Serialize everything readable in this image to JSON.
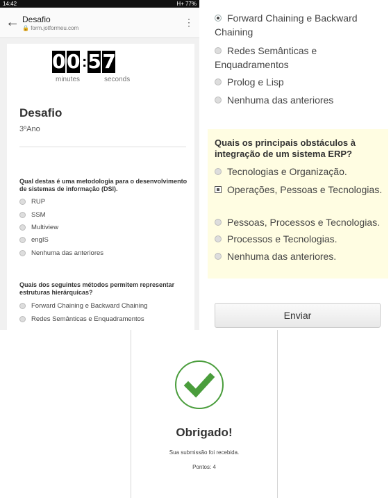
{
  "status_bar": {
    "time": "14:42",
    "indicators": "H+ 77%"
  },
  "header": {
    "title": "Desafio",
    "url": "form.jotformeu.com",
    "back_icon": "back-arrow-icon",
    "menu_icon": "more-vert-icon"
  },
  "timer": {
    "minute_digits": [
      "0",
      "0"
    ],
    "second_digits": [
      "5",
      "7"
    ],
    "separator": ":",
    "minutes_label": "minutes",
    "seconds_label": "seconds"
  },
  "form": {
    "title": "Desafio",
    "subtitle": "3ºAno",
    "q1": {
      "question": "Qual destas é uma metodologia para o desenvolvimento de sistemas de informação (DSI).",
      "options": [
        "RUP",
        "SSM",
        "Multiview",
        "engIS",
        "Nenhuma das anteriores"
      ]
    },
    "q2": {
      "question": "Quais dos seguintes métodos permitem representar estruturas hierárquicas?",
      "options": [
        "Forward Chaining e Backward Chaining",
        "Redes Semânticas e Enquadramentos"
      ]
    }
  },
  "right": {
    "q2_options": [
      "Forward Chaining e Backward Chaining",
      "Redes Semânticas e Enquadramentos",
      "Prolog e Lisp",
      "Nenhuma das anteriores"
    ],
    "q3": {
      "question": "Quais os principais obstáculos à integração de um sistema ERP?",
      "options": [
        "Tecnologias e Organização.",
        "Operações, Pessoas e Tecnologias.",
        "Pessoas, Processos e Tecnologias.",
        "Processos e Tecnologias.",
        "Nenhuma das anteriores."
      ],
      "selected_index": 1
    },
    "submit_label": "Enviar"
  },
  "confirmation": {
    "title": "Obrigado!",
    "message": "Sua submissão foi recebida.",
    "score": "Pontos: 4",
    "icon": "checkmark-icon",
    "icon_color": "#4a9d3c"
  }
}
